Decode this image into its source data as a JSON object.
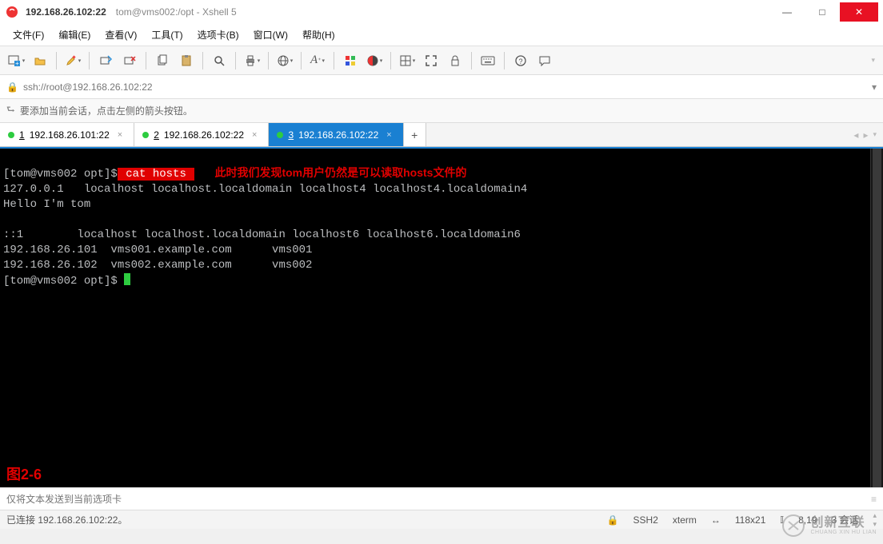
{
  "window": {
    "host": "192.168.26.102:22",
    "title_rest": "tom@vms002:/opt - Xshell 5"
  },
  "menu": {
    "file": "文件(F)",
    "edit": "编辑(E)",
    "view": "查看(V)",
    "tools": "工具(T)",
    "tabs": "选项卡(B)",
    "window": "窗口(W)",
    "help": "帮助(H)"
  },
  "toolbar_icons": {
    "new": "new-session-icon",
    "open": "open-icon",
    "highlight": "highlighter-icon",
    "reconnect": "reconnect-icon",
    "disconnect": "disconnect-icon",
    "copy": "copy-icon",
    "paste": "paste-icon",
    "find": "search-icon",
    "print": "printer-icon",
    "globe": "globe-icon",
    "font": "font-icon",
    "color": "palette-icon",
    "script": "theme-icon",
    "fullscreen": "fullscreen-icon",
    "lock": "lock-icon",
    "keyboard": "keyboard-icon",
    "help": "help-icon",
    "chat": "chat-icon"
  },
  "address": {
    "lock_icon": "lock-icon",
    "url": "ssh://root@192.168.26.102:22"
  },
  "hint": {
    "icon": "arrow-add-icon",
    "text": "要添加当前会话，点击左侧的箭头按钮。"
  },
  "tabs": {
    "items": [
      {
        "num": "1",
        "label": "192.168.26.101:22",
        "active": false
      },
      {
        "num": "2",
        "label": "192.168.26.102:22",
        "active": false
      },
      {
        "num": "3",
        "label": "192.168.26.102:22",
        "active": true
      }
    ],
    "add": "+"
  },
  "terminal": {
    "line1_prompt": "[tom@vms002 opt]$",
    "line1_cmd": " cat hosts ",
    "line1_note": "此时我们发现tom用户仍然是可以读取hosts文件的",
    "line2": "127.0.0.1   localhost localhost.localdomain localhost4 localhost4.localdomain4",
    "line3": "Hello I'm tom",
    "line4": "",
    "line5": "::1        localhost localhost.localdomain localhost6 localhost6.localdomain6",
    "line6": "192.168.26.101  vms001.example.com      vms001",
    "line7": "192.168.26.102  vms002.example.com      vms002",
    "line8_prompt": "[tom@vms002 opt]$ ",
    "figlabel": "图2-6"
  },
  "send": {
    "placeholder": "仅将文本发送到当前选项卡"
  },
  "status": {
    "connected": "已连接 192.168.26.102:22。",
    "proto_icon": "lock-icon",
    "proto": "SSH2",
    "term": "xterm",
    "size_icon": "resize-icon",
    "size": "118x21",
    "pos_icon": "cursor-pos-icon",
    "pos": "8,19",
    "sessions": "3 会话"
  },
  "watermark": {
    "big": "创新互联",
    "small": "CHUANG XIN HU LIAN"
  }
}
